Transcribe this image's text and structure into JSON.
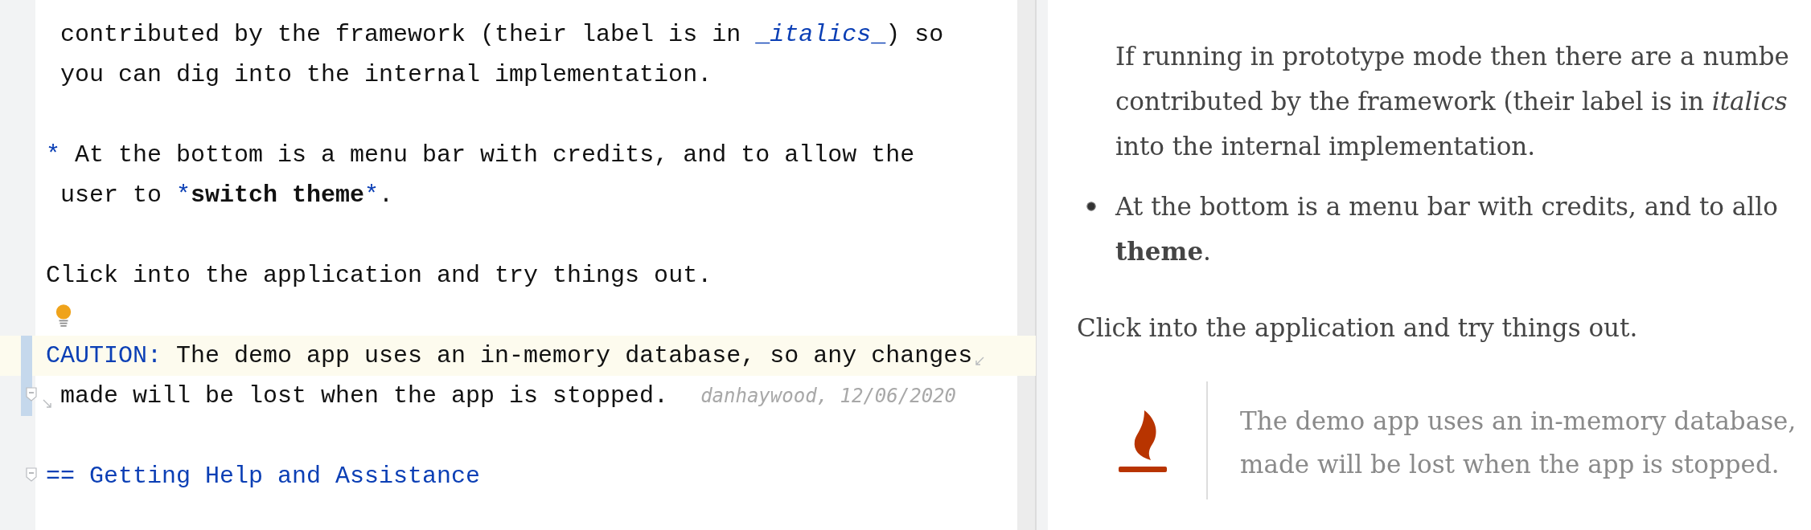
{
  "editor": {
    "lines": [
      {
        "kind": "text",
        "indent": true,
        "parts": [
          {
            "text": "contributed by the framework (their label is in ",
            "kind": "plain"
          },
          {
            "text": "_",
            "kind": "markup"
          },
          {
            "text": "italics",
            "kind": "markup-italic"
          },
          {
            "text": "_",
            "kind": "markup"
          },
          {
            "text": ") so",
            "kind": "plain"
          }
        ]
      },
      {
        "kind": "text",
        "indent": true,
        "parts": [
          {
            "text": "you can dig into the internal implementation.",
            "kind": "plain"
          }
        ]
      },
      {
        "kind": "blank"
      },
      {
        "kind": "text",
        "indent": false,
        "parts": [
          {
            "text": "*",
            "kind": "markup"
          },
          {
            "text": " At the bottom is a menu bar with credits, and to allow the",
            "kind": "plain"
          }
        ]
      },
      {
        "kind": "text",
        "indent": true,
        "parts": [
          {
            "text": "user to ",
            "kind": "plain"
          },
          {
            "text": "*",
            "kind": "markup"
          },
          {
            "text": "switch theme",
            "kind": "bold"
          },
          {
            "text": "*",
            "kind": "markup"
          },
          {
            "text": ".",
            "kind": "plain"
          }
        ]
      },
      {
        "kind": "blank"
      },
      {
        "kind": "text",
        "indent": false,
        "parts": [
          {
            "text": "Click into the application and try things out.",
            "kind": "plain"
          }
        ]
      },
      {
        "kind": "intention"
      },
      {
        "kind": "text",
        "indent": false,
        "current": true,
        "changed": true,
        "soft_wrap": true,
        "parts": [
          {
            "text": "CAUTION:",
            "kind": "markup"
          },
          {
            "text": " The demo app uses an in-memory database, so any changes",
            "kind": "plain"
          }
        ]
      },
      {
        "kind": "text",
        "indent": true,
        "changed": true,
        "fold": true,
        "wrap_start": true,
        "annotation": "danhaywood, 12/06/2020",
        "parts": [
          {
            "text": "made will be lost when the app is stopped.",
            "kind": "plain"
          }
        ]
      },
      {
        "kind": "blank"
      },
      {
        "kind": "text",
        "indent": false,
        "fold": true,
        "parts": [
          {
            "text": "== Getting Help and Assistance",
            "kind": "markup"
          }
        ]
      }
    ]
  },
  "preview": {
    "paragraph": {
      "lines": [
        "If running in prototype mode then there are a numbe",
        "contributed by the framework (their label is in *italics*",
        "into the internal implementation."
      ]
    },
    "bullet": {
      "lines": [
        "At the bottom is a menu bar with credits, and to allo",
        "**theme**."
      ]
    },
    "text": "Click into the application and try things out.",
    "admonition": {
      "kind": "caution",
      "lines": [
        "The demo app uses an in-memory database,",
        "made will be lost when the app is stopped."
      ]
    }
  }
}
